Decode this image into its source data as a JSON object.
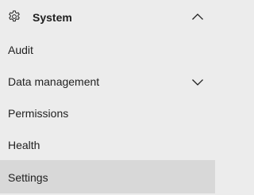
{
  "section": {
    "title": "System",
    "icon": "gear-icon",
    "expanded": true
  },
  "items": [
    {
      "label": "Audit"
    },
    {
      "label": "Data management",
      "has_children": true
    },
    {
      "label": "Permissions"
    },
    {
      "label": "Health"
    },
    {
      "label": "Settings",
      "selected": true
    }
  ],
  "colors": {
    "background": "#ececec",
    "selected_background": "#d8d8d8",
    "text": "#1f1f1f"
  }
}
